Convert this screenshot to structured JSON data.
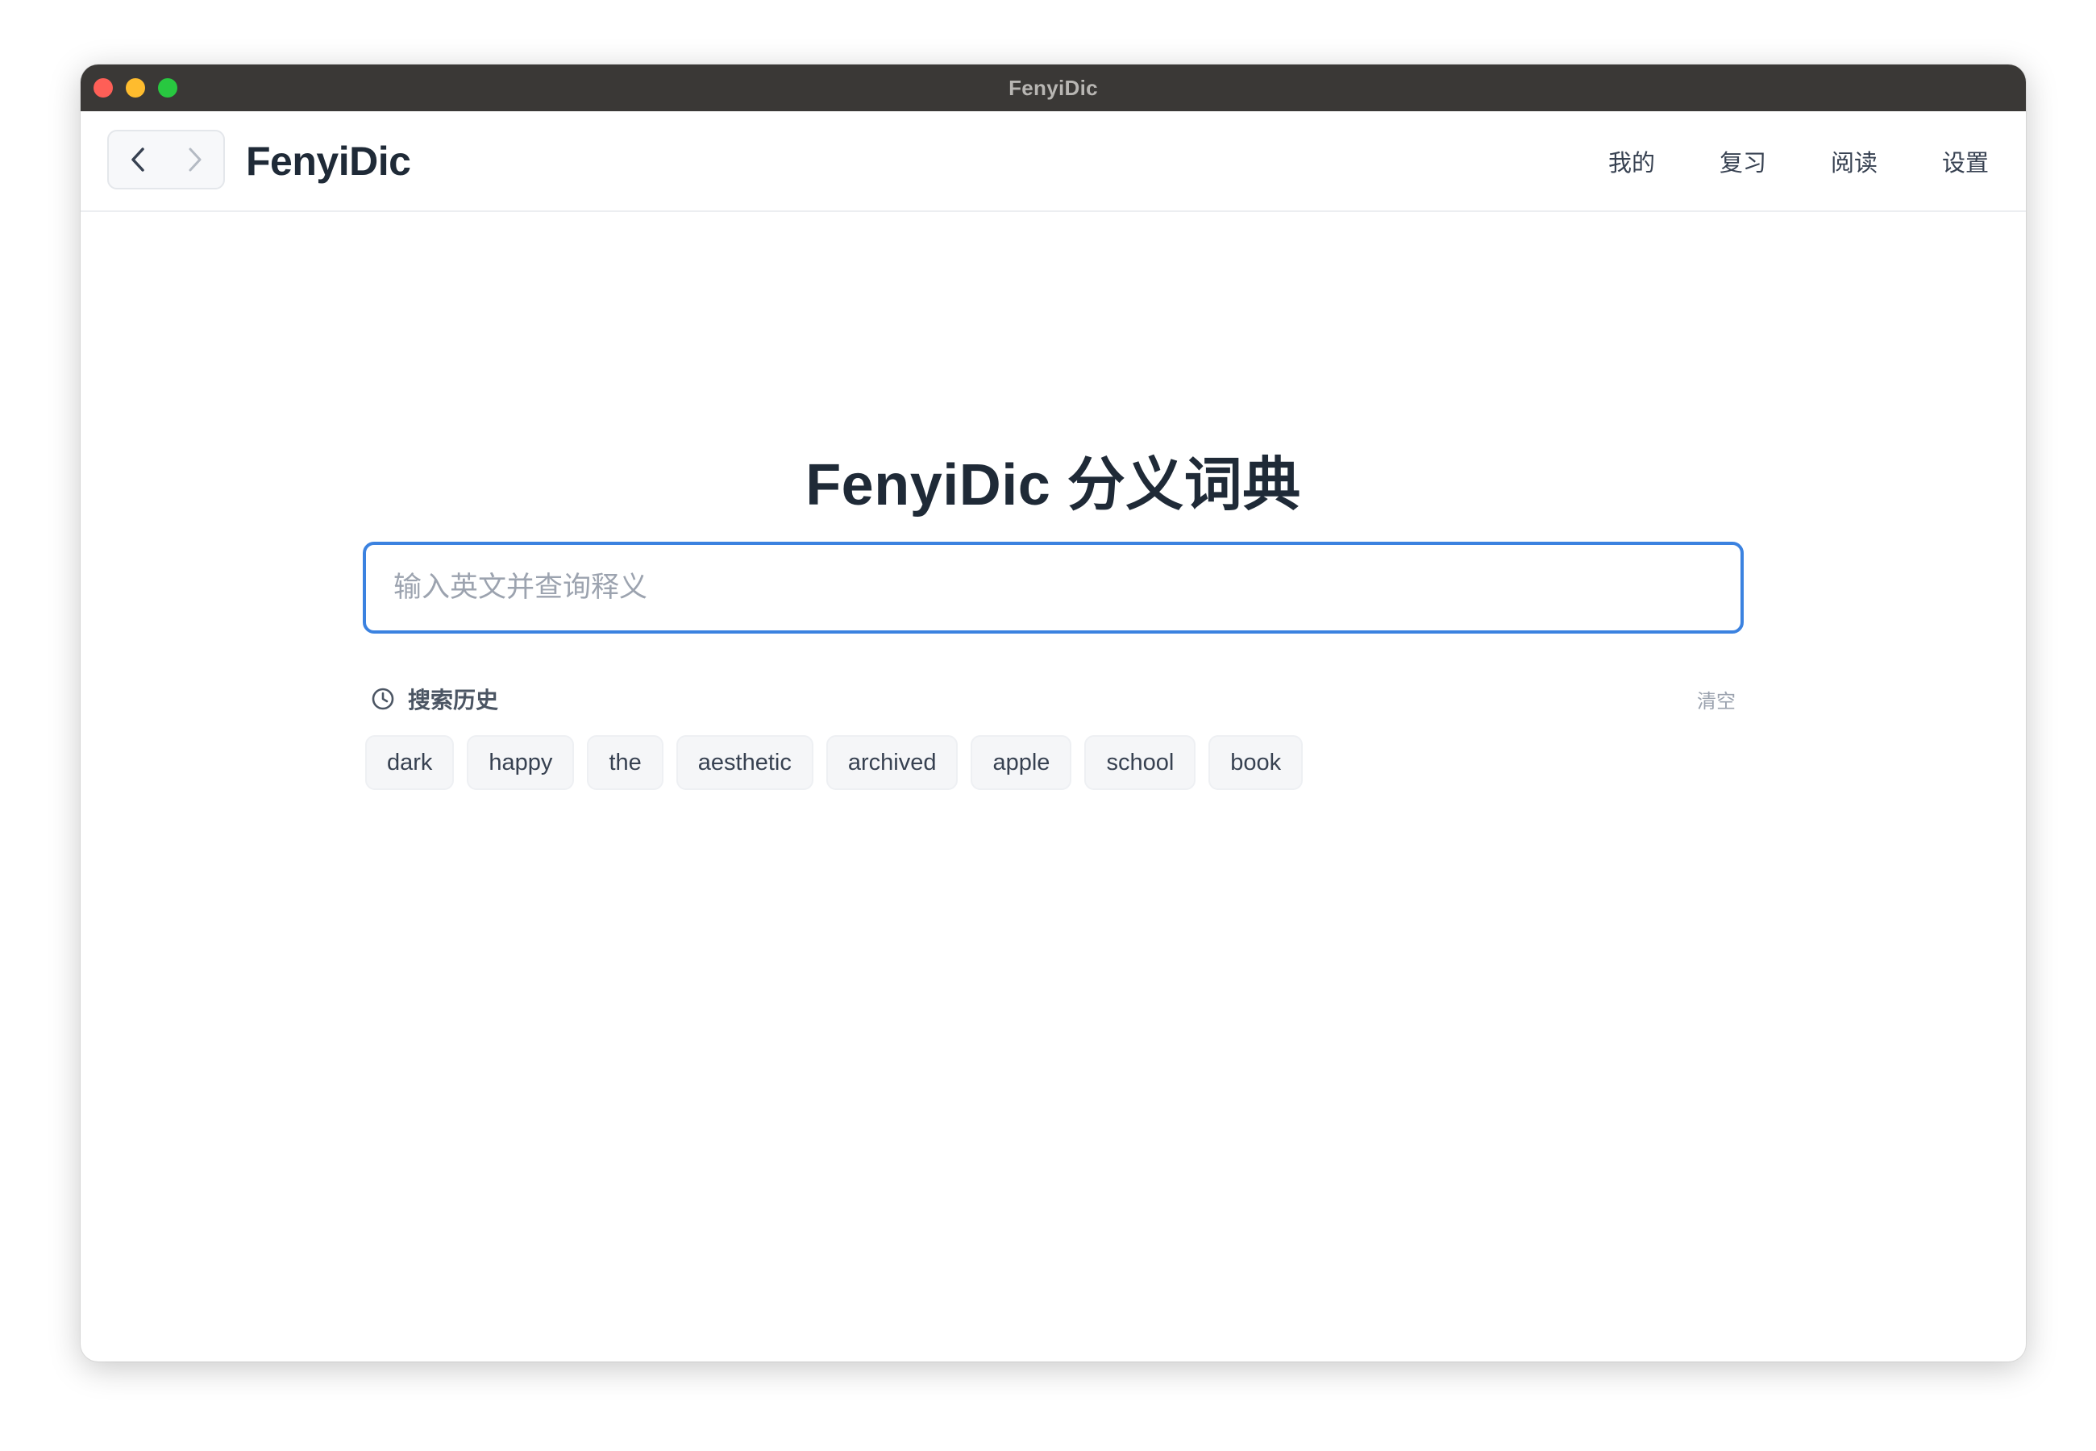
{
  "window": {
    "title": "FenyiDic",
    "traffic_colors": {
      "close": "#fe5f57",
      "minimize": "#febc2e",
      "zoom": "#28c840"
    }
  },
  "appbar": {
    "brand": "FenyiDic",
    "menu": [
      {
        "label": "我的"
      },
      {
        "label": "复习"
      },
      {
        "label": "阅读"
      },
      {
        "label": "设置"
      }
    ]
  },
  "main": {
    "title": "FenyiDic 分义词典",
    "search": {
      "placeholder": "输入英文并查询释义",
      "value": "",
      "accent": "#3b82e0"
    },
    "history": {
      "label": "搜索历史",
      "clear_label": "清空",
      "items": [
        "dark",
        "happy",
        "the",
        "aesthetic",
        "archived",
        "apple",
        "school",
        "book"
      ]
    }
  }
}
